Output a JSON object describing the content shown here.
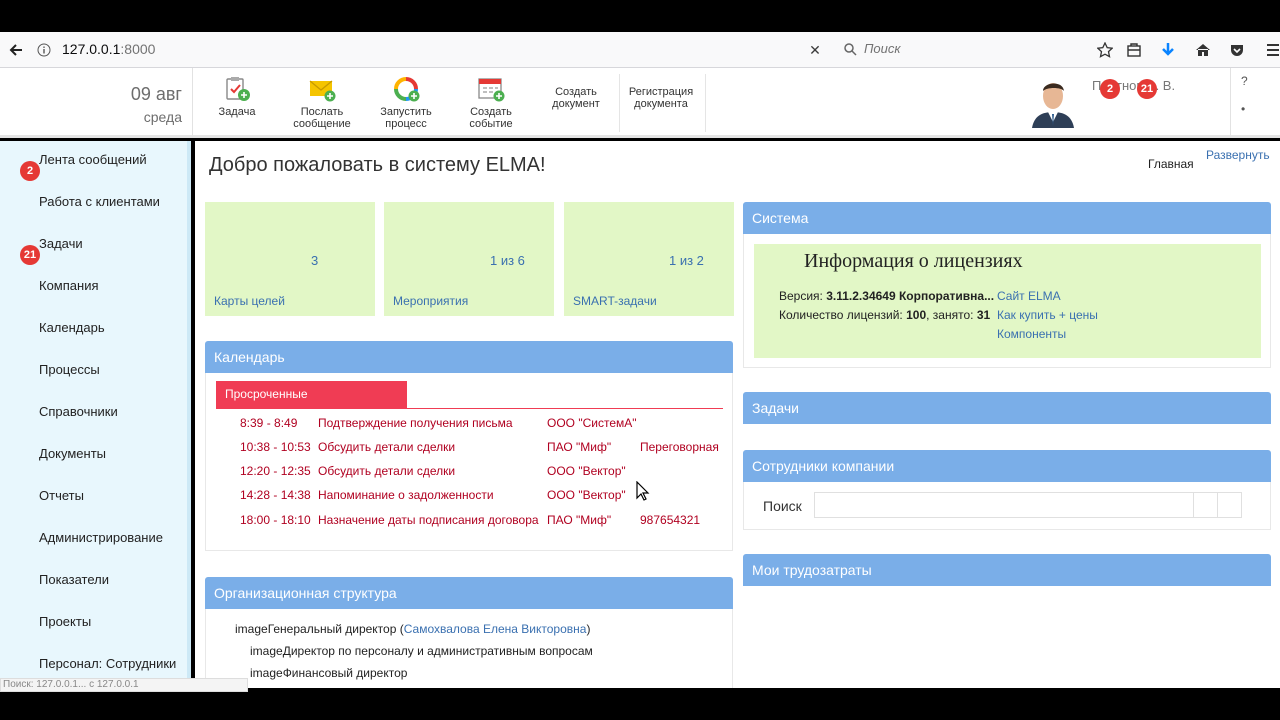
{
  "browser": {
    "url_host": "127.0.0.1",
    "url_port": ":8000",
    "search_placeholder": "Поиск"
  },
  "header": {
    "date_day": "09 авг",
    "date_weekday": "среда",
    "toolbar": [
      {
        "label": "Задача",
        "icon": "task-icon"
      },
      {
        "label": "Послать сообщение",
        "icon": "envelope-icon"
      },
      {
        "label": "Запустить процесс",
        "icon": "process-icon"
      },
      {
        "label": "Создать событие",
        "icon": "calendar-event-icon"
      },
      {
        "label": "Создать документ",
        "icon": ""
      },
      {
        "label": "Регистрация документа",
        "icon": ""
      }
    ],
    "user_name": "Плотнов А. В.",
    "badge_messages": "2",
    "badge_tasks": "21",
    "help": "?",
    "help_dot": "•"
  },
  "sidebar": {
    "items": [
      {
        "label": "Лента сообщений",
        "badge": "2"
      },
      {
        "label": "Работа с клиентами"
      },
      {
        "label": "Задачи",
        "badge": "21"
      },
      {
        "label": "Компания"
      },
      {
        "label": "Календарь"
      },
      {
        "label": "Процессы"
      },
      {
        "label": "Справочники"
      },
      {
        "label": "Документы"
      },
      {
        "label": "Отчеты"
      },
      {
        "label": "Администрирование"
      },
      {
        "label": "Показатели"
      },
      {
        "label": "Проекты"
      },
      {
        "label": "Персонал: Сотрудники"
      }
    ]
  },
  "main": {
    "title": "Добро пожаловать в систему ELMA!",
    "crumb_main": "Главная",
    "crumb_expand": "Развернуть",
    "tiles": [
      {
        "value": "3",
        "caption": "Карты целей"
      },
      {
        "value": "1 из 6",
        "caption": "Мероприятия"
      },
      {
        "value": "1 из 2",
        "caption": "SMART-задачи"
      }
    ],
    "calendar": {
      "title": "Календарь",
      "tab": "Просроченные",
      "events": [
        {
          "time": "8:39 - 8:49",
          "subject": "Подтверждение получения письма",
          "org": "ООО \"СистемА\"",
          "place": ""
        },
        {
          "time": "10:38 - 10:53",
          "subject": "Обсудить детали сделки",
          "org": "ПАО \"Миф\"",
          "place": "Переговорная"
        },
        {
          "time": "12:20 - 12:35",
          "subject": "Обсудить детали сделки",
          "org": "ООО \"Вектор\"",
          "place": ""
        },
        {
          "time": "14:28 - 14:38",
          "subject": "Напоминание о задолженности",
          "org": "ООО \"Вектор\"",
          "place": ""
        },
        {
          "time": "18:00 - 18:10",
          "subject": "Назначение даты подписания договора",
          "org": "ПАО \"Миф\"",
          "place": "987654321"
        }
      ]
    },
    "org": {
      "title": "Организационная структура",
      "rows": [
        {
          "img": "image",
          "text": "Генеральный директор (",
          "link": "Самохвалова Елена Викторовна",
          "tail": ")"
        },
        {
          "img": "image",
          "text": "Директор по персоналу и административным вопросам"
        },
        {
          "img": "image",
          "text": "Финансовый директор"
        }
      ]
    },
    "system": {
      "title": "Система",
      "license_title": "Информация о лицензиях",
      "version_label": "Версия: ",
      "version_value": "3.11.2.34649 Корпоративна...",
      "count_label": "Количество лицензий: ",
      "count_value": "100",
      "busy_label": ", занято: ",
      "busy_value": "31",
      "links": [
        "Сайт ELMA",
        "Как купить + цены",
        "Компоненты"
      ]
    },
    "tasks_title": "Задачи",
    "employees": {
      "title": "Сотрудники компании",
      "search_label": "Поиск"
    },
    "labor_title": "Мои трудозатраты"
  },
  "status_bar": "Поиск: 127.0.0.1... с 127.0.0.1",
  "colors": {
    "panel_head": "#7aaee8",
    "tile_bg": "#e2f7c6",
    "overdue": "#f03c54",
    "sidebar_bg": "#e8f7fd",
    "badge": "#e53935"
  }
}
